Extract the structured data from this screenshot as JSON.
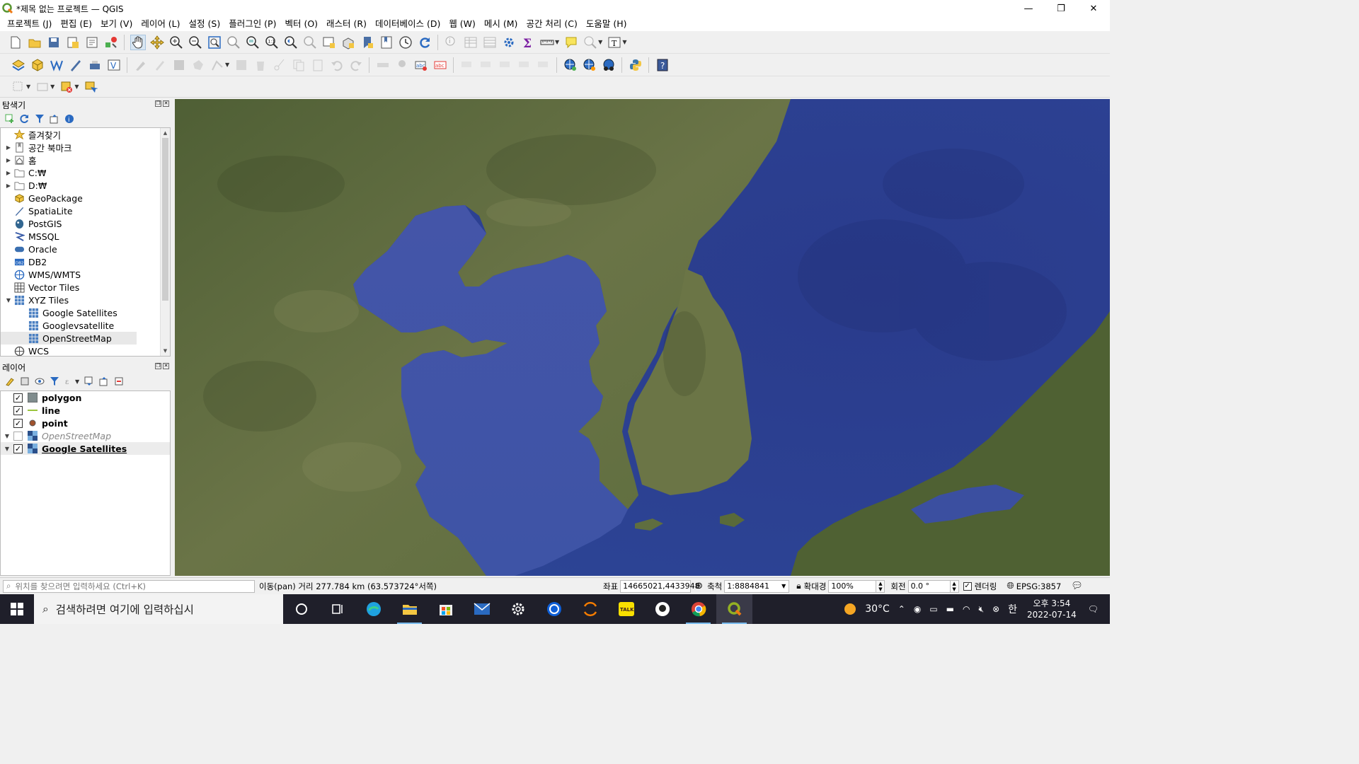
{
  "window": {
    "title": "*제목 없는 프로젝트 — QGIS",
    "controls": [
      "—",
      "❐",
      "✕"
    ]
  },
  "menu": [
    "프로젝트 (J)",
    "편집 (E)",
    "보기 (V)",
    "레이어 (L)",
    "설정 (S)",
    "플러그인 (P)",
    "벡터 (O)",
    "래스터 (R)",
    "데이터베이스 (D)",
    "웹 (W)",
    "메시 (M)",
    "공간 처리 (C)",
    "도움말 (H)"
  ],
  "browser_panel": {
    "title": "탐색기",
    "items": [
      {
        "label": "즐겨찾기",
        "icon": "star-icon",
        "arrow": "",
        "indent": 0
      },
      {
        "label": "공간 북마크",
        "icon": "bookmark-icon",
        "arrow": "▶",
        "indent": 0
      },
      {
        "label": "홈",
        "icon": "home-icon",
        "arrow": "▶",
        "indent": 0
      },
      {
        "label": "C:₩",
        "icon": "folder-icon",
        "arrow": "▶",
        "indent": 0
      },
      {
        "label": "D:₩",
        "icon": "folder-icon",
        "arrow": "▶",
        "indent": 0
      },
      {
        "label": "GeoPackage",
        "icon": "geopackage-icon",
        "arrow": "",
        "indent": 0
      },
      {
        "label": "SpatiaLite",
        "icon": "spatialite-icon",
        "arrow": "",
        "indent": 0
      },
      {
        "label": "PostGIS",
        "icon": "postgis-icon",
        "arrow": "",
        "indent": 0
      },
      {
        "label": "MSSQL",
        "icon": "mssql-icon",
        "arrow": "",
        "indent": 0
      },
      {
        "label": "Oracle",
        "icon": "oracle-icon",
        "arrow": "",
        "indent": 0
      },
      {
        "label": "DB2",
        "icon": "db2-icon",
        "arrow": "",
        "indent": 0
      },
      {
        "label": "WMS/WMTS",
        "icon": "wms-icon",
        "arrow": "",
        "indent": 0
      },
      {
        "label": "Vector Tiles",
        "icon": "vector-tiles-icon",
        "arrow": "",
        "indent": 0
      },
      {
        "label": "XYZ Tiles",
        "icon": "xyz-tiles-icon",
        "arrow": "▼",
        "indent": 0
      },
      {
        "label": "Google Satellites",
        "icon": "xyz-tiles-icon",
        "arrow": "",
        "indent": 1
      },
      {
        "label": "Googlevsatellite",
        "icon": "xyz-tiles-icon",
        "arrow": "",
        "indent": 1
      },
      {
        "label": "OpenStreetMap",
        "icon": "xyz-tiles-icon",
        "arrow": "",
        "indent": 1,
        "selected": true
      },
      {
        "label": "WCS",
        "icon": "wcs-icon",
        "arrow": "",
        "indent": 0
      }
    ]
  },
  "layers_panel": {
    "title": "레이어",
    "layers": [
      {
        "name": "polygon",
        "checked": true,
        "icon": "polygon-layer-icon",
        "arrow": "",
        "style": "bold"
      },
      {
        "name": "line",
        "checked": true,
        "icon": "line-layer-icon",
        "arrow": "",
        "style": "bold"
      },
      {
        "name": "point",
        "checked": true,
        "icon": "point-layer-icon",
        "arrow": "",
        "style": "bold"
      },
      {
        "name": "OpenStreetMap",
        "checked": false,
        "icon": "raster-layer-icon",
        "arrow": "▼",
        "style": "italic"
      },
      {
        "name": "Google Satellites",
        "checked": true,
        "icon": "raster-layer-icon",
        "arrow": "▼",
        "style": "underline"
      }
    ]
  },
  "statusbar": {
    "locator_placeholder": "위치를 찾으려면 입력하세요 (Ctrl+K)",
    "message": "이동(pan) 거리 277.784 km (63.573724°서쪽)",
    "coord_label": "좌표",
    "coord_value": "14665021,4433948",
    "scale_label": "축척",
    "scale_value": "1:8884841",
    "magnifier_label": "확대경",
    "magnifier_value": "100%",
    "rotation_label": "회전",
    "rotation_value": "0.0 °",
    "render_label": "렌더링",
    "crs": "EPSG:3857"
  },
  "taskbar": {
    "search_placeholder": "검색하려면 여기에 입력하십시",
    "apps": [
      "cortana-icon",
      "task-view-icon",
      "edge-icon",
      "file-explorer-icon",
      "store-icon",
      "mail-icon",
      "settings-icon",
      "teamviewer-icon",
      "eclipse-icon",
      "kakaotalk-icon",
      "github-icon",
      "chrome-icon",
      "qgis-icon"
    ],
    "temperature": "30°C",
    "ime": "한",
    "time": "오후 3:54",
    "date": "2022-07-14"
  },
  "colors": {
    "sea": "#2d3f8f",
    "land": "#5c6b3a",
    "taskbar": "#1f1f2a",
    "selection": "#d8e6f2"
  }
}
